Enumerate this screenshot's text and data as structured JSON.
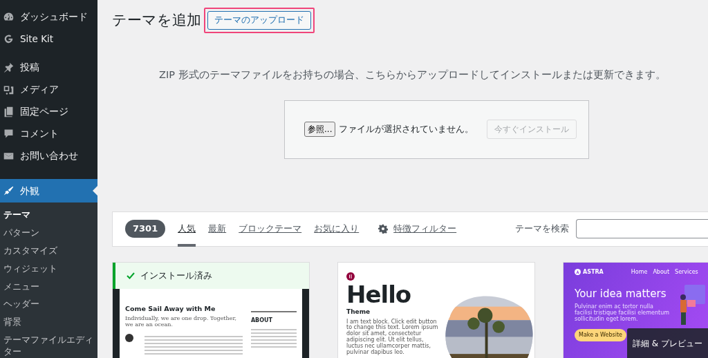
{
  "sidebar": {
    "menu": [
      {
        "label": "ダッシュボード",
        "selected": false
      },
      {
        "label": "Site Kit",
        "selected": false
      },
      {
        "label": "投稿",
        "selected": false
      },
      {
        "label": "メディア",
        "selected": false
      },
      {
        "label": "固定ページ",
        "selected": false
      },
      {
        "label": "コメント",
        "selected": false
      },
      {
        "label": "お問い合わせ",
        "selected": false
      },
      {
        "label": "外観",
        "selected": true
      }
    ],
    "submenu": [
      {
        "label": "テーマ",
        "selected": true
      },
      {
        "label": "パターン",
        "selected": false
      },
      {
        "label": "カスタマイズ",
        "selected": false
      },
      {
        "label": "ウィジェット",
        "selected": false
      },
      {
        "label": "メニュー",
        "selected": false
      },
      {
        "label": "ヘッダー",
        "selected": false
      },
      {
        "label": "背景",
        "selected": false
      },
      {
        "label": "テーマファイルエディター",
        "selected": false
      }
    ]
  },
  "page": {
    "title": "テーマを追加",
    "upload_button": "テーマのアップロード",
    "description": "ZIP 形式のテーマファイルをお持ちの場合、こちらからアップロードしてインストールまたは更新できます。",
    "upload_form": {
      "browse_button": "参照...",
      "file_status": "ファイルが選択されていません。",
      "install_button": "今すぐインストール",
      "install_disabled": true
    }
  },
  "filter_bar": {
    "count": "7301",
    "tabs": [
      {
        "label": "人気",
        "selected": true
      },
      {
        "label": "最新",
        "selected": false
      },
      {
        "label": "ブロックテーマ",
        "selected": false
      },
      {
        "label": "お気に入り",
        "selected": false
      }
    ],
    "feature_filter": "特徴フィルター",
    "search_label": "テーマを検索"
  },
  "themes": [
    {
      "kind": "blog",
      "installed": true,
      "installed_label": "インストール済み",
      "headline": "Come Sail Away with Me",
      "tagline": "Individually, we are one drop. Together, we are an ocean.",
      "side_heading": "ABOUT"
    },
    {
      "kind": "hello",
      "installed": false,
      "headline": "Hello",
      "tagline": "Theme",
      "body": "I am text block. Click edit button to change this text. Lorem ipsum dolor sit amet, consectetur adipiscing elit. Ut elit tellus, luctus nec ullamcorper mattis, pulvinar dapibus leo."
    },
    {
      "kind": "astra",
      "installed": false,
      "brand": "ASTRA",
      "nav": [
        "Home",
        "About",
        "Services"
      ],
      "headline": "Your idea matters",
      "body": "Pulvinar enim ac tortor nulla facilisi tristique facilisi elementum sollicitudin eget lorem.",
      "cta": "Make a Website",
      "overlay": "詳細 & プレビュー"
    }
  ]
}
